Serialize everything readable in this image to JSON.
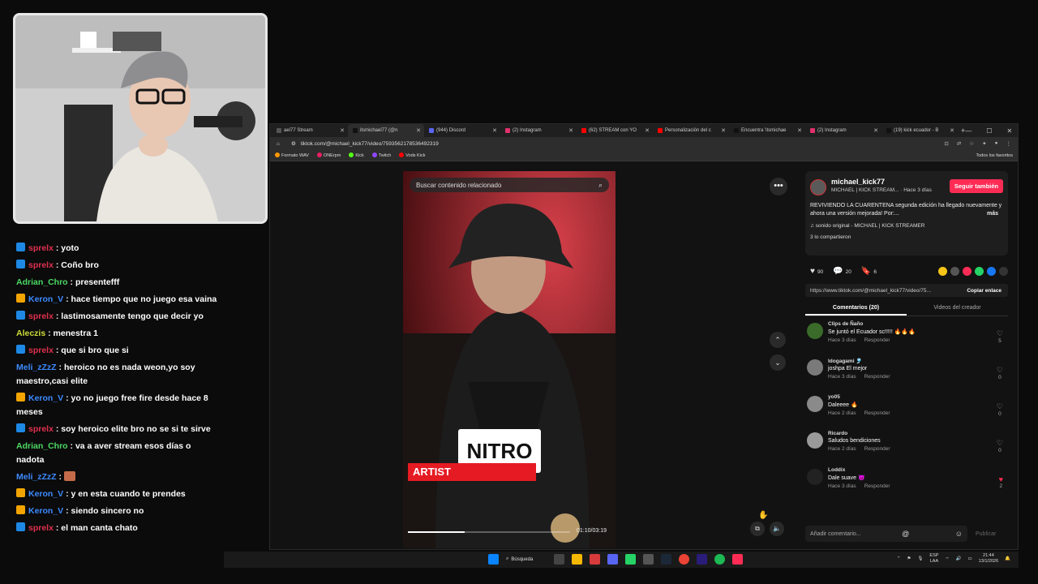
{
  "chat": [
    {
      "user": "sprelx",
      "color": "#e0304e",
      "badge": "blue",
      "text": "yoto"
    },
    {
      "user": "sprelx",
      "color": "#e0304e",
      "badge": "blue",
      "text": "Coño bro"
    },
    {
      "user": "Adrian_Chro",
      "color": "#4cd964",
      "badge": "",
      "text": "presentefff"
    },
    {
      "user": "Keron_V",
      "color": "#3d8bff",
      "badge": "orange",
      "text": "hace tiempo que no juego esa vaina"
    },
    {
      "user": "sprelx",
      "color": "#e0304e",
      "badge": "blue",
      "text": "lastimosamente tengo que decir yo"
    },
    {
      "user": "Aleczis",
      "color": "#cddc39",
      "badge": "",
      "text": "menestra 1"
    },
    {
      "user": "sprelx",
      "color": "#e0304e",
      "badge": "blue",
      "text": "que si bro que si"
    },
    {
      "user": "Meli_zZzZ",
      "color": "#3d8bff",
      "badge": "",
      "text": "heroico no es nada weon,yo soy maestro,casi elite"
    },
    {
      "user": "Keron_V",
      "color": "#3d8bff",
      "badge": "orange",
      "text": "yo no juego free fire desde hace 8 meses"
    },
    {
      "user": "sprelx",
      "color": "#e0304e",
      "badge": "blue",
      "text": "soy heroico elite bro no se si te sirve"
    },
    {
      "user": "Adrian_Chro",
      "color": "#4cd964",
      "badge": "",
      "text": "va a aver stream esos días o nadota"
    },
    {
      "user": "Meli_zZzZ",
      "color": "#3d8bff",
      "badge": "",
      "text": ""
    },
    {
      "user": "Keron_V",
      "color": "#3d8bff",
      "badge": "orange",
      "text": "y en esta cuando te prendes"
    },
    {
      "user": "Keron_V",
      "color": "#3d8bff",
      "badge": "orange",
      "text": "siendo sincero no"
    },
    {
      "user": "sprelx",
      "color": "#e0304e",
      "badge": "blue",
      "text": "el man canta chato"
    }
  ],
  "browser": {
    "tabs": [
      {
        "label": "ael77 Stream",
        "color": "#555"
      },
      {
        "label": "itsmichael77 (@n",
        "color": "#111"
      },
      {
        "label": "(944) Discord",
        "color": "#5865f2"
      },
      {
        "label": "(2) Instagram",
        "color": "#e1306c"
      },
      {
        "label": "(62) STREAM con YO",
        "color": "#ff0000"
      },
      {
        "label": "Personalización del c",
        "color": "#ff0000"
      },
      {
        "label": "Encuentra 'itsmichae",
        "color": "#111"
      },
      {
        "label": "(2) Instagram",
        "color": "#e1306c"
      },
      {
        "label": "(19) kick ecuador - B",
        "color": "#111"
      }
    ],
    "url": "tiktok.com/@michael_kick77/video/7593562178536492319",
    "bookmarks": [
      "Formato WAV",
      "ONErpm",
      "Kick",
      "Twitch",
      "Vods Kick"
    ],
    "bookmarks_right": "Todos los favoritos"
  },
  "video": {
    "search_placeholder": "Buscar contenido relacionado",
    "title_text": "NITRO",
    "artist_text": "ARTIST",
    "time": "01:10/03:19",
    "progress": 0.35
  },
  "creator": {
    "name": "michael_kick77",
    "sub": "MICHAEL | KICK STREAM... · Hace 3 días",
    "follow": "Seguir también",
    "desc": "REVIVIENDO LA CUARENTENA segunda edición ha llegado nuevamente y ahora una versión mejorada! Por:...",
    "mas": "más",
    "sound": "♫  sonido original - MICHAEL | KICK STREAMER",
    "shared": "3 lo compartieron"
  },
  "stats": {
    "likes": "90",
    "comments": "20",
    "saves": "6"
  },
  "link": {
    "url": "https://www.tiktok.com/@michael_kick77/video/75...",
    "copy": "Copiar enlace"
  },
  "tabs": {
    "comments": "Comentarios (20)",
    "videos": "Videos del creador"
  },
  "comments": [
    {
      "user": "Clips de Ñaño",
      "text": "Se juntó el Ecuador sc!!!!! 🔥🔥🔥",
      "time": "Hace 3 días",
      "reply": "Responder",
      "likes": "5",
      "liked": false,
      "avatar": "#3a6b2a"
    },
    {
      "user": "ldogagami 🎐",
      "text": "joshpa El mejor",
      "time": "Hace 3 días",
      "reply": "Responder",
      "likes": "0",
      "liked": false,
      "avatar": "#7a7a7a"
    },
    {
      "user": "yo05",
      "text": "Daleeee 🔥",
      "time": "Hace 2 días",
      "reply": "Responder",
      "likes": "0",
      "liked": false,
      "avatar": "#8a8a8a"
    },
    {
      "user": "Ricardo",
      "text": "Saludos bendiciones",
      "time": "Hace 2 días",
      "reply": "Responder",
      "likes": "0",
      "liked": false,
      "avatar": "#9a9a9a"
    },
    {
      "user": "Loddix",
      "text": "Dale suave 😈",
      "time": "Hace 3 días",
      "reply": "Responder",
      "likes": "2",
      "liked": true,
      "avatar": "#222"
    }
  ],
  "add_comment": {
    "placeholder": "Añadir comentario...",
    "publish": "Publicar"
  },
  "taskbar": {
    "search": "Búsqueda",
    "lang1": "ESP",
    "lang2": "LAA",
    "time": "21:44",
    "date": "13/1/2026"
  }
}
